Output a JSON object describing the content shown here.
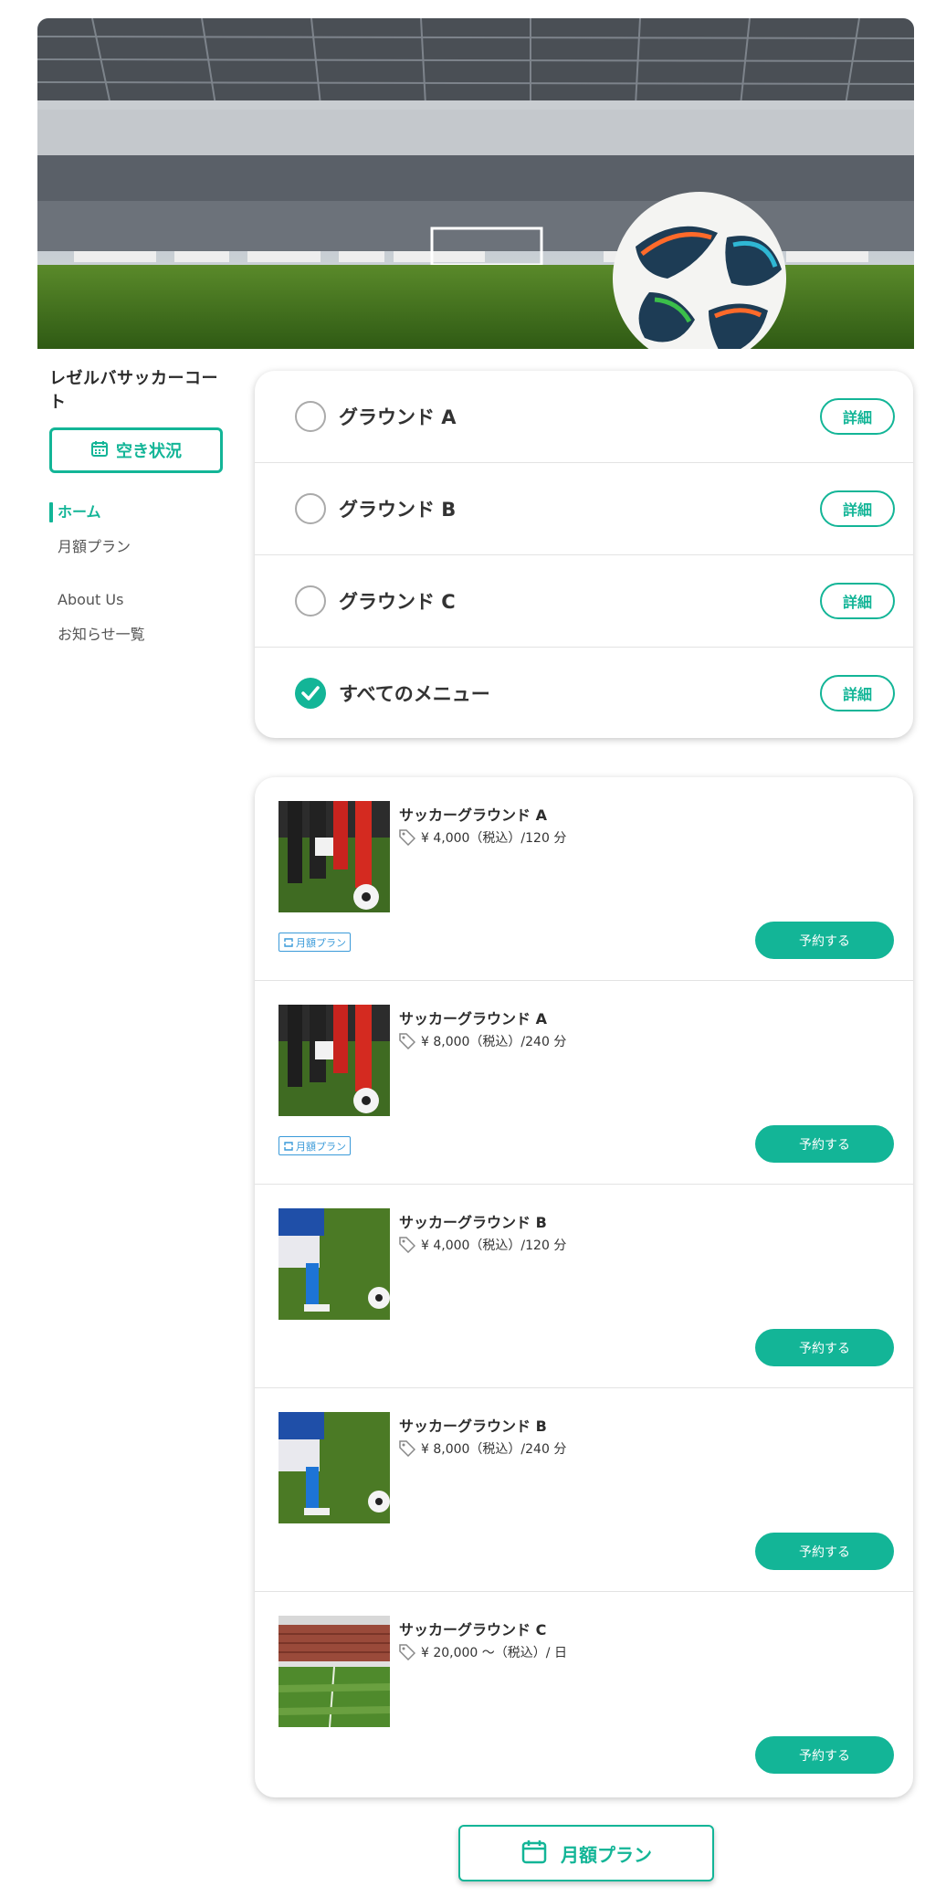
{
  "brand": {
    "name": "レゼルバサッカーコート"
  },
  "availability_button": {
    "label": "空き状況"
  },
  "nav": {
    "items": [
      {
        "label": "ホーム",
        "active": true
      },
      {
        "label": "月額プラン",
        "active": false
      },
      {
        "label": "About Us",
        "active": false
      },
      {
        "label": "お知らせ一覧",
        "active": false
      }
    ]
  },
  "filters": [
    {
      "label": "グラウンド A",
      "checked": false,
      "detail": "詳細"
    },
    {
      "label": "グラウンド B",
      "checked": false,
      "detail": "詳細"
    },
    {
      "label": "グラウンド C",
      "checked": false,
      "detail": "詳細"
    },
    {
      "label": "すべてのメニュー",
      "checked": true,
      "detail": "詳細"
    }
  ],
  "plans": [
    {
      "title": "サッカーグラウンド A",
      "price": "¥ 4,000（税込）/120 分",
      "tag": "月額プラン",
      "button": "予約する",
      "thumb": "players-red-socks"
    },
    {
      "title": "サッカーグラウンド A",
      "price": "¥ 8,000（税込）/240 分",
      "tag": "月額プラン",
      "button": "予約する",
      "thumb": "players-red-socks"
    },
    {
      "title": "サッカーグラウンド B",
      "price": "¥ 4,000（税込）/120 分",
      "tag": "",
      "button": "予約する",
      "thumb": "player-blue-socks"
    },
    {
      "title": "サッカーグラウンド B",
      "price": "¥ 8,000（税込）/240 分",
      "tag": "",
      "button": "予約する",
      "thumb": "player-blue-socks"
    },
    {
      "title": "サッカーグラウンド C",
      "price": "¥ 20,000 〜（税込）/ 日",
      "tag": "",
      "button": "予約する",
      "thumb": "stadium-field"
    }
  ],
  "monthly_button": {
    "label": "月額プラン"
  },
  "colors": {
    "accent": "#13b597",
    "tag_blue": "#3a9ad9"
  },
  "icons": {
    "calendar": "calendar-icon",
    "price_tag": "price-tag-icon",
    "check": "check-icon",
    "repeat": "repeat-icon"
  }
}
